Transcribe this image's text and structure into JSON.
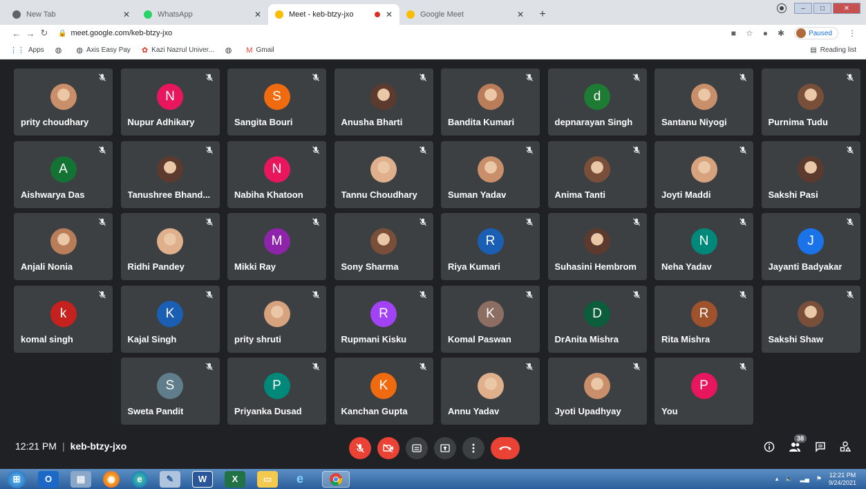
{
  "browser": {
    "tabs": [
      {
        "title": "New Tab",
        "favicon_color": "#5f6368",
        "active": false,
        "recording": false
      },
      {
        "title": "WhatsApp",
        "favicon_color": "#25d366",
        "active": false,
        "recording": false
      },
      {
        "title": "Meet - keb-btzy-jxo",
        "favicon_color": "#fbbc04",
        "active": true,
        "recording": true
      },
      {
        "title": "Google Meet",
        "favicon_color": "#fbbc04",
        "active": false,
        "recording": false
      }
    ],
    "new_tab_glyph": "+",
    "url": "meet.google.com/keb-btzy-jxo",
    "profile_status": "Paused",
    "bookmarks": [
      {
        "label": "Apps",
        "icon": "apps-grid-icon"
      },
      {
        "label": "",
        "icon": "globe-icon"
      },
      {
        "label": "Axis Easy Pay",
        "icon": "globe-icon"
      },
      {
        "label": "Kazi Nazrul Univer...",
        "icon": "university-icon"
      },
      {
        "label": "",
        "icon": "globe-icon"
      },
      {
        "label": "Gmail",
        "icon": "gmail-icon"
      }
    ],
    "reading_list": "Reading list"
  },
  "meet": {
    "time": "12:21 PM",
    "meeting_code": "keb-btzy-jxo",
    "participant_count": "38",
    "participants": [
      {
        "name": "prity choudhary",
        "initial": "",
        "color": ""
      },
      {
        "name": "Nupur Adhikary",
        "initial": "N",
        "color": "#e8175d"
      },
      {
        "name": "Sangita Bouri",
        "initial": "S",
        "color": "#f06a0f"
      },
      {
        "name": "Anusha Bharti",
        "initial": "",
        "color": ""
      },
      {
        "name": "Bandita Kumari",
        "initial": "",
        "color": ""
      },
      {
        "name": "depnarayan Singh",
        "initial": "d",
        "color": "#1e7b34"
      },
      {
        "name": "Santanu Niyogi",
        "initial": "",
        "color": ""
      },
      {
        "name": "Purnima Tudu",
        "initial": "",
        "color": ""
      },
      {
        "name": "Aishwarya Das",
        "initial": "A",
        "color": "#137333"
      },
      {
        "name": "Tanushree Bhand...",
        "initial": "",
        "color": ""
      },
      {
        "name": "Nabiha Khatoon",
        "initial": "N",
        "color": "#e8175d"
      },
      {
        "name": "Tannu Choudhary",
        "initial": "",
        "color": ""
      },
      {
        "name": "Suman Yadav",
        "initial": "",
        "color": ""
      },
      {
        "name": "Anima Tanti",
        "initial": "",
        "color": ""
      },
      {
        "name": "Joyti Maddi",
        "initial": "",
        "color": ""
      },
      {
        "name": "Sakshi Pasi",
        "initial": "",
        "color": ""
      },
      {
        "name": "Anjali Nonia",
        "initial": "",
        "color": ""
      },
      {
        "name": "Ridhi Pandey",
        "initial": "",
        "color": ""
      },
      {
        "name": "Mikki Ray",
        "initial": "M",
        "color": "#8e24aa"
      },
      {
        "name": "Sony Sharma",
        "initial": "",
        "color": ""
      },
      {
        "name": "Riya Kumari",
        "initial": "R",
        "color": "#1a5fb4"
      },
      {
        "name": "Suhasini Hembrom",
        "initial": "",
        "color": ""
      },
      {
        "name": "Neha Yadav",
        "initial": "N",
        "color": "#00897b"
      },
      {
        "name": "Jayanti Badyakar",
        "initial": "J",
        "color": "#1a73e8"
      },
      {
        "name": "komal singh",
        "initial": "k",
        "color": "#c5221f"
      },
      {
        "name": "Kajal Singh",
        "initial": "K",
        "color": "#1a5fb4"
      },
      {
        "name": "prity shruti",
        "initial": "",
        "color": ""
      },
      {
        "name": "Rupmani Kisku",
        "initial": "R",
        "color": "#a142f4"
      },
      {
        "name": "Komal Paswan",
        "initial": "K",
        "color": "#8d6e63"
      },
      {
        "name": "DrAnita Mishra",
        "initial": "D",
        "color": "#0b5d3b"
      },
      {
        "name": "Rita Mishra",
        "initial": "R",
        "color": "#a0522d"
      },
      {
        "name": "Sakshi Shaw",
        "initial": "",
        "color": ""
      },
      {
        "name": "Sweta Pandit",
        "initial": "S",
        "color": "#607d8b"
      },
      {
        "name": "Priyanka Dusad",
        "initial": "P",
        "color": "#00897b"
      },
      {
        "name": "Kanchan Gupta",
        "initial": "K",
        "color": "#f06a0f"
      },
      {
        "name": "Annu Yadav",
        "initial": "",
        "color": ""
      },
      {
        "name": "Jyoti Upadhyay",
        "initial": "",
        "color": ""
      },
      {
        "name": "You",
        "initial": "P",
        "color": "#e8175d"
      }
    ]
  },
  "taskbar": {
    "apps": [
      "start-orb",
      "outlook",
      "files",
      "firefox",
      "edge",
      "paint",
      "word",
      "excel",
      "explorer",
      "ie",
      "chrome"
    ],
    "tray_time": "12:21 PM",
    "tray_date": "9/24/2021"
  }
}
